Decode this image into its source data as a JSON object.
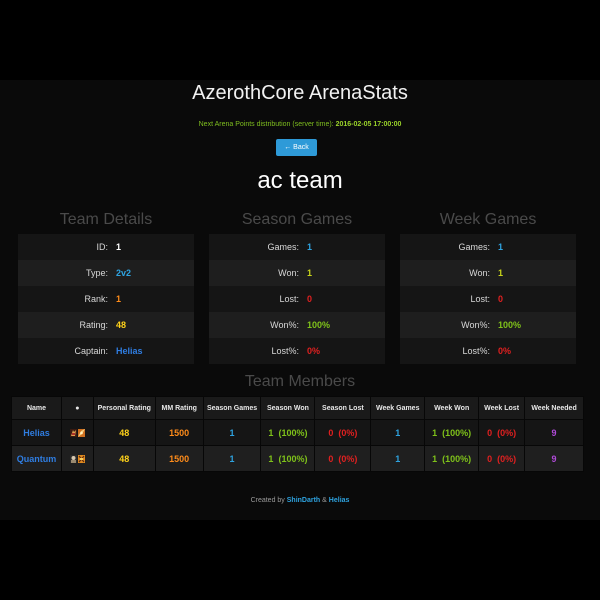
{
  "header": {
    "title": "AzerothCore ArenaStats",
    "next_label": "Next Arena Points distribution (server time):",
    "next_time": "2016-02-05 17:00:00",
    "back_label": "← Back",
    "team_name": "ac team"
  },
  "team_details": {
    "title": "Team Details",
    "rows": [
      {
        "label": "ID:",
        "value": "1",
        "color": "#ffffff"
      },
      {
        "label": "Type:",
        "value": "2v2",
        "color": "#2ea3e0"
      },
      {
        "label": "Rank:",
        "value": "1",
        "color": "#ff8c1a"
      },
      {
        "label": "Rating:",
        "value": "48",
        "color": "#ffd21a"
      },
      {
        "label": "Captain:",
        "value": "Helias",
        "color": "#2f7de1"
      }
    ]
  },
  "season_games": {
    "title": "Season Games",
    "rows": [
      {
        "label": "Games:",
        "value": "1",
        "color": "#2ea3e0"
      },
      {
        "label": "Won:",
        "value": "1",
        "color": "#c8d41a"
      },
      {
        "label": "Lost:",
        "value": "0",
        "color": "#e02020"
      },
      {
        "label": "Won%:",
        "value": "100%",
        "color": "#7fc21a"
      },
      {
        "label": "Lost%:",
        "value": "0%",
        "color": "#e02020"
      }
    ]
  },
  "week_games": {
    "title": "Week Games",
    "rows": [
      {
        "label": "Games:",
        "value": "1",
        "color": "#2ea3e0"
      },
      {
        "label": "Won:",
        "value": "1",
        "color": "#c8d41a"
      },
      {
        "label": "Lost:",
        "value": "0",
        "color": "#e02020"
      },
      {
        "label": "Won%:",
        "value": "100%",
        "color": "#7fc21a"
      },
      {
        "label": "Lost%:",
        "value": "0%",
        "color": "#e02020"
      }
    ]
  },
  "members": {
    "title": "Team Members",
    "columns": [
      "Name",
      "●",
      "Personal Rating",
      "MM Rating",
      "Season Games",
      "Season Won",
      "Season Lost",
      "Week Games",
      "Week Won",
      "Week Lost",
      "Week Needed"
    ],
    "rows": [
      {
        "name": "Helias",
        "icons": [
          "blood-elf-icon",
          "mage-icon"
        ],
        "personal_rating": "48",
        "mm_rating": "1500",
        "season_games": "1",
        "season_won": "1",
        "season_won_pct": "(100%)",
        "season_lost": "0",
        "season_lost_pct": "(0%)",
        "week_games": "1",
        "week_won": "1",
        "week_won_pct": "(100%)",
        "week_lost": "0",
        "week_lost_pct": "(0%)",
        "week_needed": "9"
      },
      {
        "name": "Quantum",
        "icons": [
          "human-icon",
          "warrior-icon"
        ],
        "personal_rating": "48",
        "mm_rating": "1500",
        "season_games": "1",
        "season_won": "1",
        "season_won_pct": "(100%)",
        "season_lost": "0",
        "season_lost_pct": "(0%)",
        "week_games": "1",
        "week_won": "1",
        "week_won_pct": "(100%)",
        "week_lost": "0",
        "week_lost_pct": "(0%)",
        "week_needed": "9"
      }
    ]
  },
  "footer": {
    "prefix": "Created by",
    "author1": "ShinDarth",
    "amp": "&",
    "author2": "Helias"
  },
  "colors": {
    "name": "#2f7de1",
    "rating": "#ffd21a",
    "mm": "#ff8c1a",
    "games": "#2ea3e0",
    "won": "#7fc21a",
    "lost": "#e02020",
    "needed": "#b04ad8"
  }
}
